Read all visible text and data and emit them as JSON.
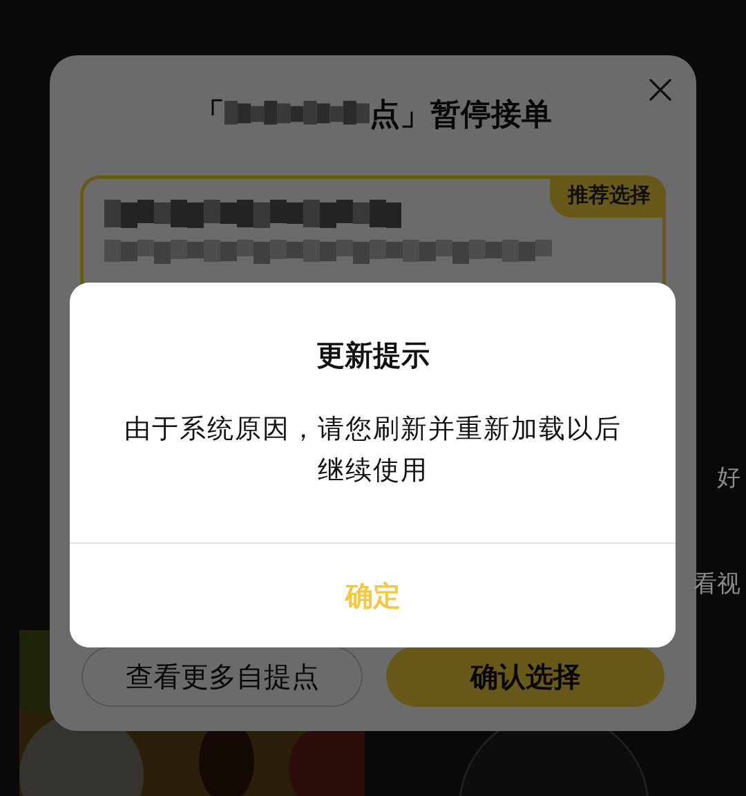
{
  "background": {
    "side_texts": [
      {
        "text": "好"
      },
      {
        "text": "看视"
      }
    ]
  },
  "sheet": {
    "title_open": "「",
    "title_close": "点」暂停接单",
    "card": {
      "badge": "推荐选择",
      "selected": true
    },
    "buttons": [
      {
        "label": "查看更多自提点",
        "kind": "outline"
      },
      {
        "label": "确认选择",
        "kind": "primary"
      }
    ]
  },
  "alert": {
    "title": "更新提示",
    "message": "由于系统原因，请您刷新并重新加载以后继续使用",
    "button": "确定"
  }
}
